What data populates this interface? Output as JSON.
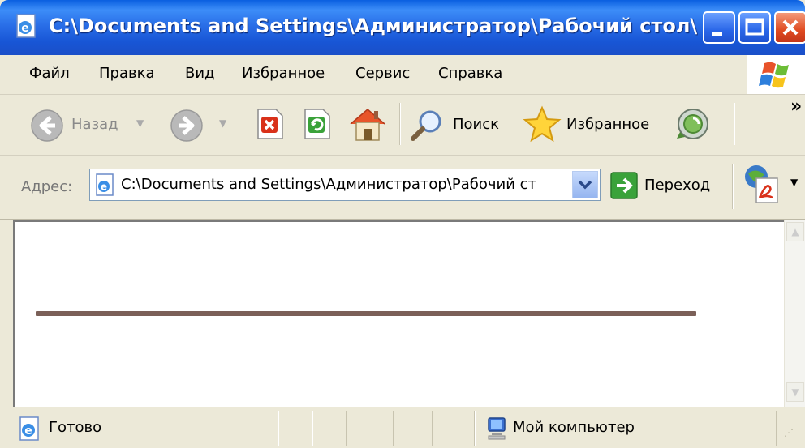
{
  "window": {
    "title": "C:\\Documents and Settings\\Администратор\\Рабочий стол\\Сп..."
  },
  "menu": {
    "items": [
      {
        "prefix": "",
        "accel": "Ф",
        "rest": "айл"
      },
      {
        "prefix": "",
        "accel": "П",
        "rest": "равка"
      },
      {
        "prefix": "",
        "accel": "В",
        "rest": "ид"
      },
      {
        "prefix": "",
        "accel": "И",
        "rest": "збранное"
      },
      {
        "prefix": "Се",
        "accel": "р",
        "rest": "вис"
      },
      {
        "prefix": "",
        "accel": "С",
        "rest": "правка"
      }
    ]
  },
  "toolbar": {
    "back_label": "Назад",
    "search_label": "Поиск",
    "favorites_label": "Избранное",
    "chevron": "»"
  },
  "address": {
    "label": "Адрес:",
    "value": "C:\\Documents and Settings\\Администратор\\Рабочий ст",
    "go_label": "Переход"
  },
  "status": {
    "text": "Готово",
    "zone": "Мой компьютер"
  },
  "icons": {
    "window": "ie-page-icon",
    "back": "back-arrow-icon",
    "forward": "forward-arrow-icon",
    "stop": "stop-icon",
    "refresh": "refresh-icon",
    "home": "home-icon",
    "search": "search-icon",
    "favorites": "star-icon",
    "media": "media-icon",
    "go": "go-arrow-icon",
    "pdf": "pdf-icon",
    "computer": "computer-icon"
  },
  "colors": {
    "title_blue": "#1a56d6",
    "chrome": "#ece9d8",
    "rule": "#7b6058",
    "go_green": "#3aa23a",
    "stop_red": "#d9311a"
  }
}
